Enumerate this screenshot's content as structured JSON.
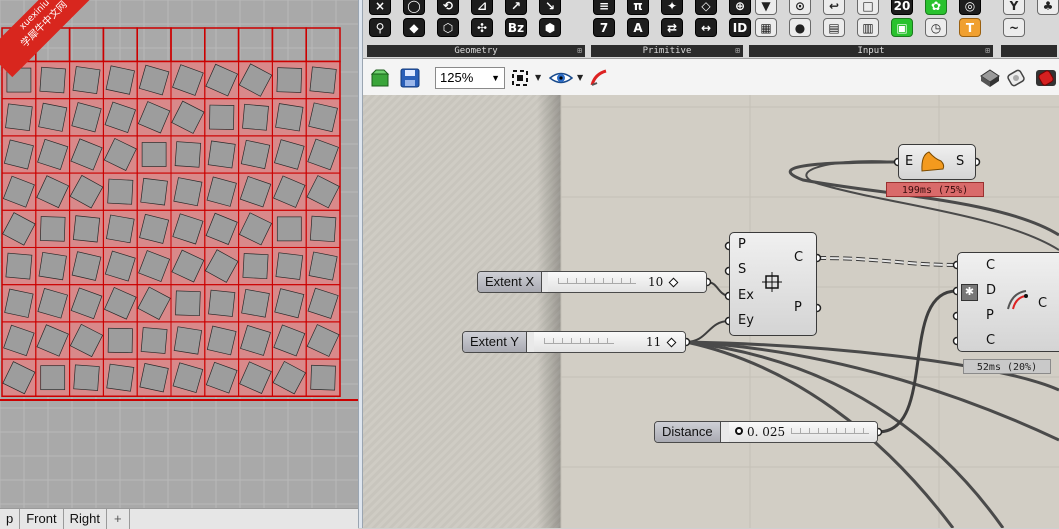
{
  "watermark": {
    "line1": "xuexiniu",
    "line2": "学犀牛中文网"
  },
  "viewport": {
    "tabs": [
      "p",
      "Front",
      "Right"
    ],
    "add_tab": "+",
    "pattern": {
      "columns": 10,
      "rows": 10,
      "outline_color": "#cc0000",
      "fill_color": "#d9898a",
      "tile_color": "#9d9d9d"
    }
  },
  "ribbon": {
    "panels": [
      {
        "label": "Geometry"
      },
      {
        "label": "Primitive"
      },
      {
        "label": "Input"
      }
    ],
    "buttons": {
      "geometry": [
        "×",
        "◯",
        "⟲",
        "⊿",
        "↗",
        "↘",
        "⚲",
        "◆",
        "⬡",
        "✣",
        "Bz",
        "⬢"
      ],
      "primitive": [
        "≡",
        "π",
        "✦",
        "◇",
        "⊕",
        "7",
        "A",
        "⇄",
        "↔",
        "ID"
      ],
      "input_top": [
        "▼",
        "⊙",
        "↩",
        "□",
        "20",
        "✿",
        "◎"
      ],
      "input_bottom": [
        "▦",
        "●",
        "▤",
        "▥",
        "▣",
        "◷",
        "T",
        "/"
      ],
      "extra": [
        "Y",
        "♣",
        "~"
      ]
    }
  },
  "toolbar": {
    "zoom": "125%",
    "icons": [
      "new-document-icon",
      "save-icon",
      "zoom-extents-icon",
      "preview-eye-icon",
      "sketch-brush-icon",
      "shaded-preview-icon",
      "wire-preview-icon",
      "render-red-icon"
    ]
  },
  "canvas": {
    "sliders": {
      "extent_x": {
        "label": "Extent X",
        "value": "10"
      },
      "extent_y": {
        "label": "Extent Y",
        "value": "11"
      },
      "distance": {
        "label": "Distance",
        "value": "0. 025"
      }
    },
    "components": {
      "rectangle": {
        "inputs": [
          "P",
          "S",
          "Ex",
          "Ey"
        ],
        "outputs": [
          "C",
          "P"
        ]
      },
      "surface": {
        "inputs": [
          "E"
        ],
        "outputs": [
          "S"
        ],
        "profiler": "199ms (75%)"
      },
      "offset": {
        "inputs": [
          "C",
          "D",
          "P",
          "C"
        ],
        "outputs": [
          "C"
        ],
        "profiler": "52ms (20%)"
      }
    }
  }
}
